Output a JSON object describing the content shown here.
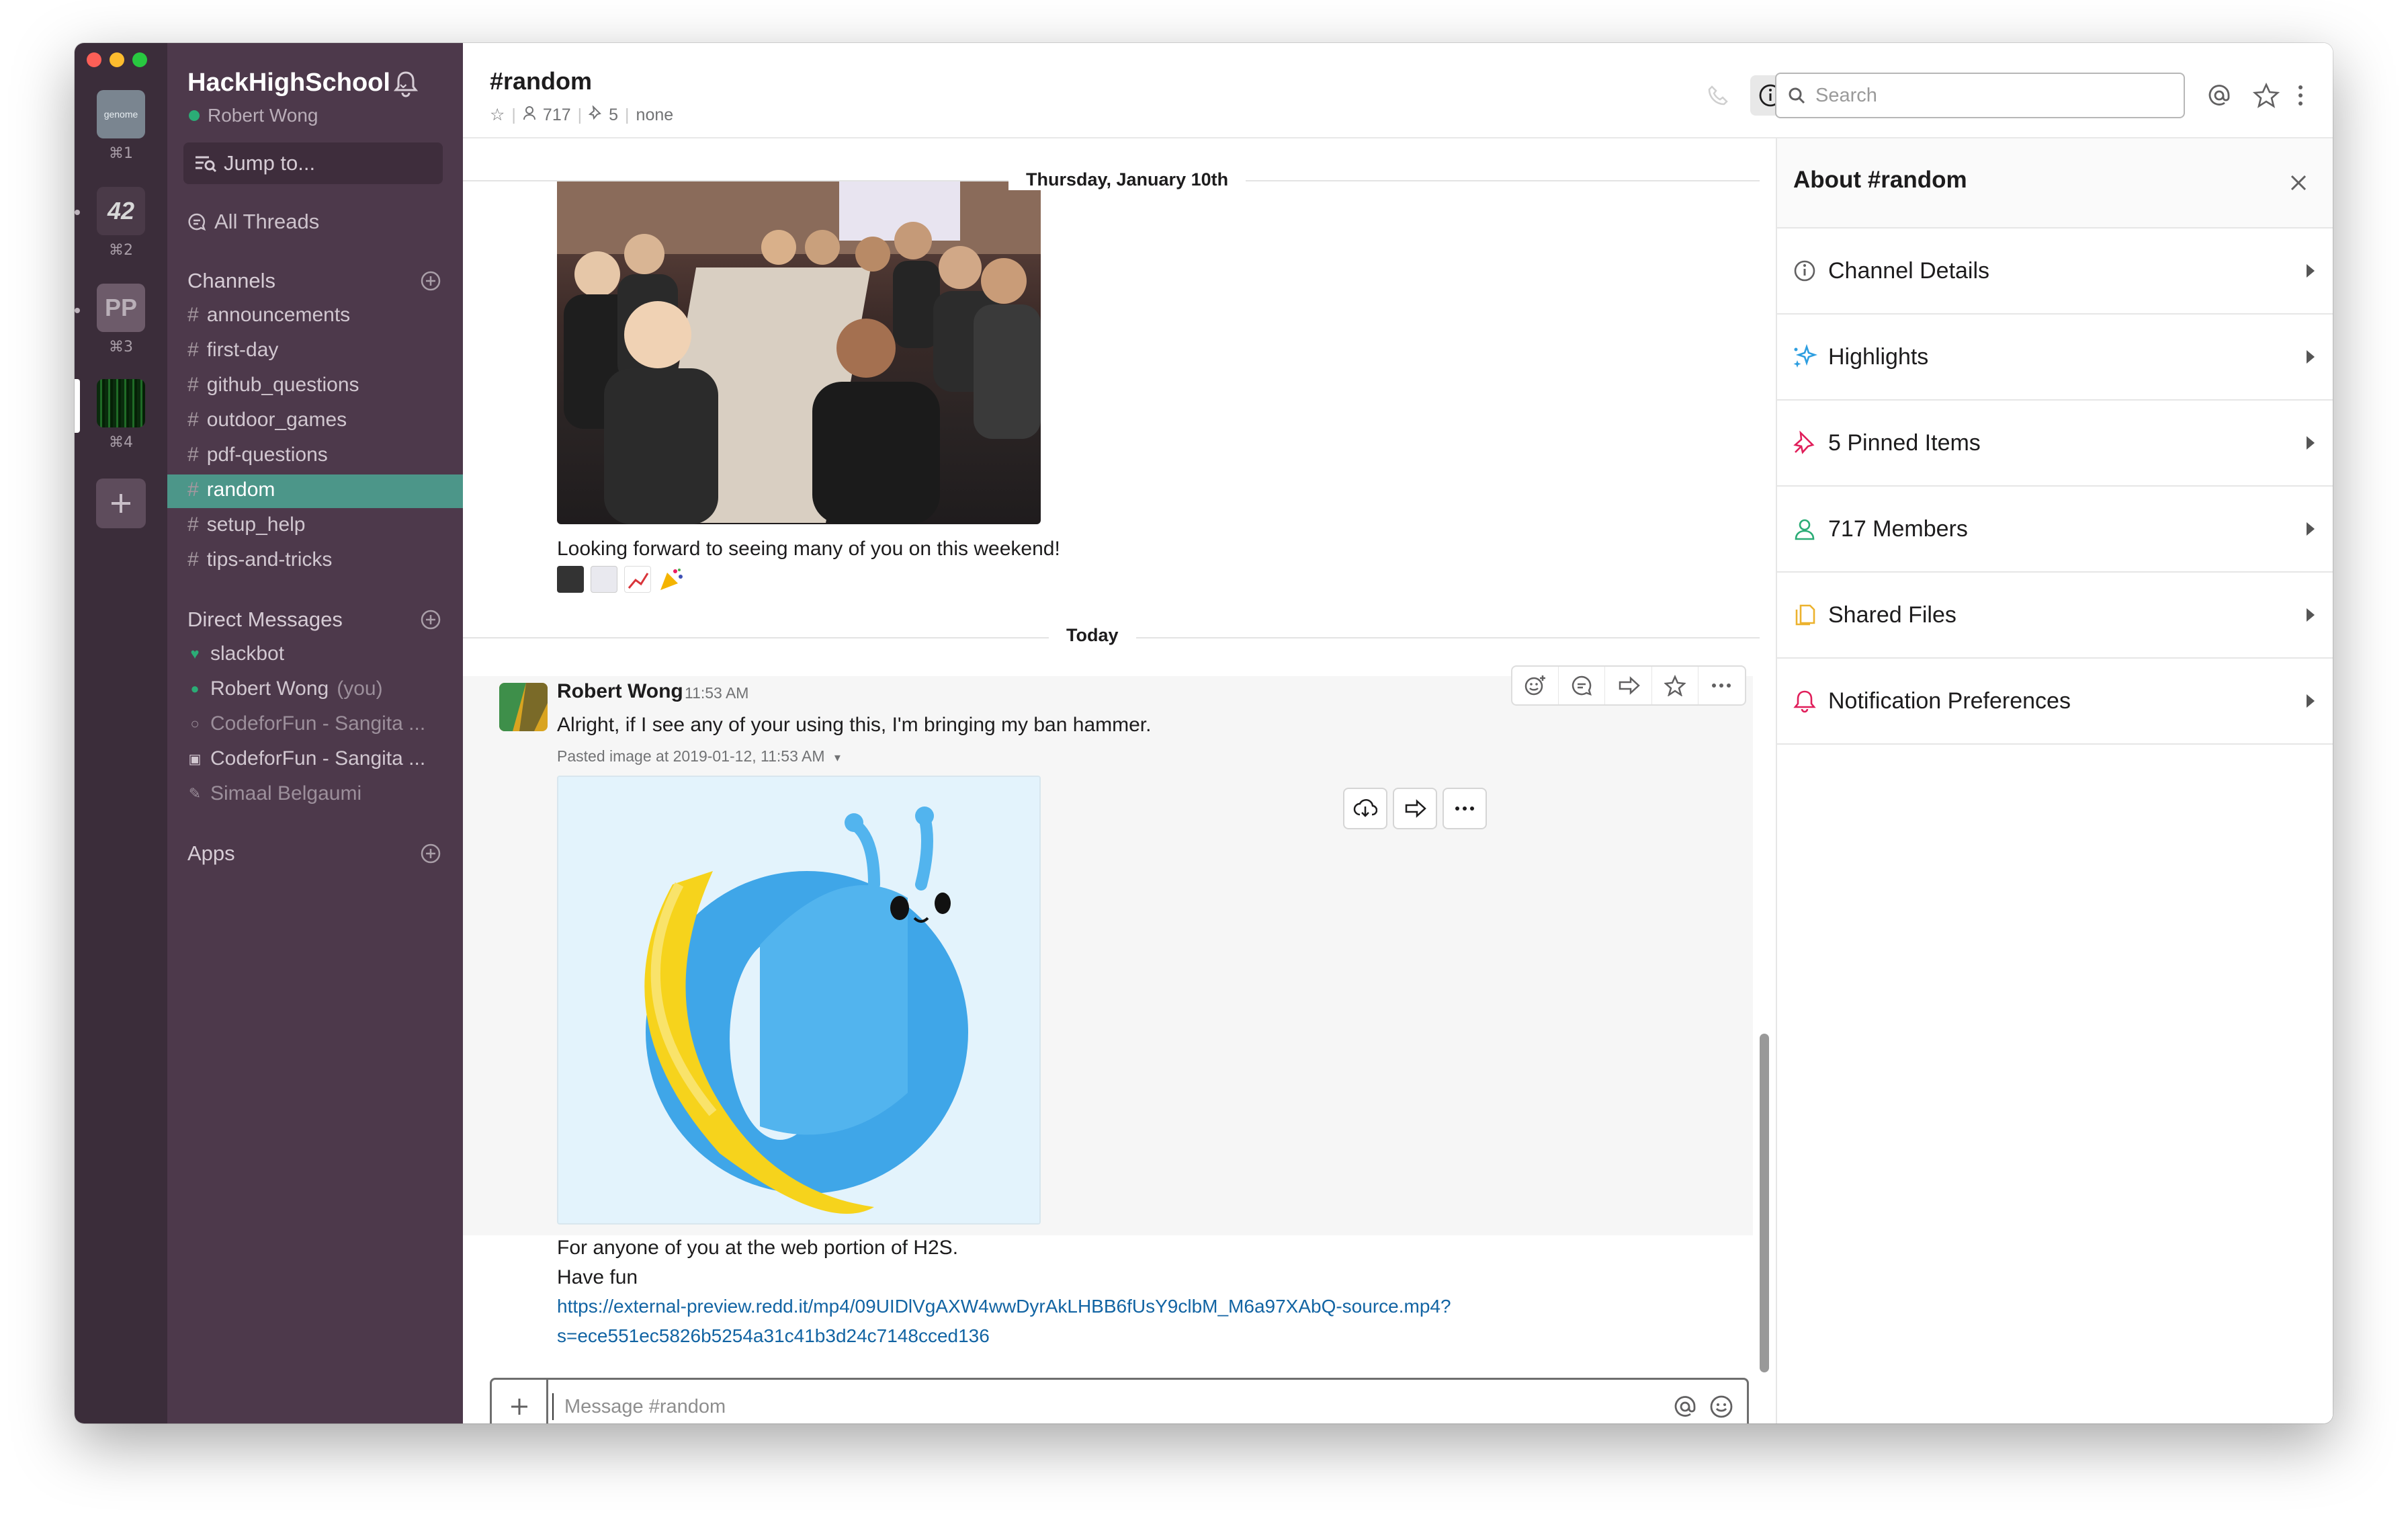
{
  "workspaces": [
    {
      "label": "genome",
      "shortcut": "⌘1",
      "color": "#7a8590"
    },
    {
      "label": "42",
      "shortcut": "⌘2",
      "color": "#4a3a48"
    },
    {
      "label": "PP",
      "shortcut": "⌘3",
      "color": "#6d5b6a"
    },
    {
      "label": "",
      "shortcut": "⌘4",
      "color": "#0f3a14"
    }
  ],
  "sidebar": {
    "team_name": "HackHighSchool",
    "user_name": "Robert Wong",
    "jump_to": "Jump to...",
    "all_threads": "All Threads",
    "channels_header": "Channels",
    "channels": [
      "announcements",
      "first-day",
      "github_questions",
      "outdoor_games",
      "pdf-questions",
      "random",
      "setup_help",
      "tips-and-tricks"
    ],
    "active_channel": "random",
    "dm_header": "Direct Messages",
    "dms": [
      "slackbot",
      "Robert Wong",
      "CodeforFun - Sangita ...",
      "CodeforFun - Sangita ...",
      "Simaal Belgaumi"
    ],
    "you_suffix": "(you)",
    "apps_header": "Apps"
  },
  "header": {
    "channel_title": "#random",
    "member_count": "717",
    "pin_count": "5",
    "topic": "none",
    "search_placeholder": "Search"
  },
  "messages": {
    "day1": "Thursday, January 10th",
    "msg1_text": "Looking forward to seeing many of you on this weekend!",
    "day2": "Today",
    "author": "Robert Wong",
    "time": "11:53 AM",
    "msg2_text": "Alright, if I see any of your using this, I'm bringing my ban hammer.",
    "pasted_label": "Pasted image at 2019-01-12, 11:53 AM",
    "msg3_line1": "For anyone of you at the web portion of H2S.",
    "msg3_line2": "Have fun",
    "link_line1": "https://external-preview.redd.it/mp4/09UIDlVgAXW4wwDyrAkLHBB6fUsY9clbM_M6a97XAbQ-source.mp4?",
    "link_line2": "s=ece551ec5826b5254a31c41b3d24c7148cced136"
  },
  "composer": {
    "placeholder": "Message #random"
  },
  "about": {
    "title": "About #random",
    "items": [
      {
        "label": "Channel Details",
        "icon": "info-icon",
        "color": "#616061"
      },
      {
        "label": "Highlights",
        "icon": "sparkle-icon",
        "color": "#2d9ee0"
      },
      {
        "label": "5 Pinned Items",
        "icon": "pin-icon",
        "color": "#e01e5a"
      },
      {
        "label": "717 Members",
        "icon": "person-icon",
        "color": "#2bac76"
      },
      {
        "label": "Shared Files",
        "icon": "files-icon",
        "color": "#ecb22e"
      },
      {
        "label": "Notification Preferences",
        "icon": "bell-icon",
        "color": "#e01e5a"
      }
    ]
  }
}
